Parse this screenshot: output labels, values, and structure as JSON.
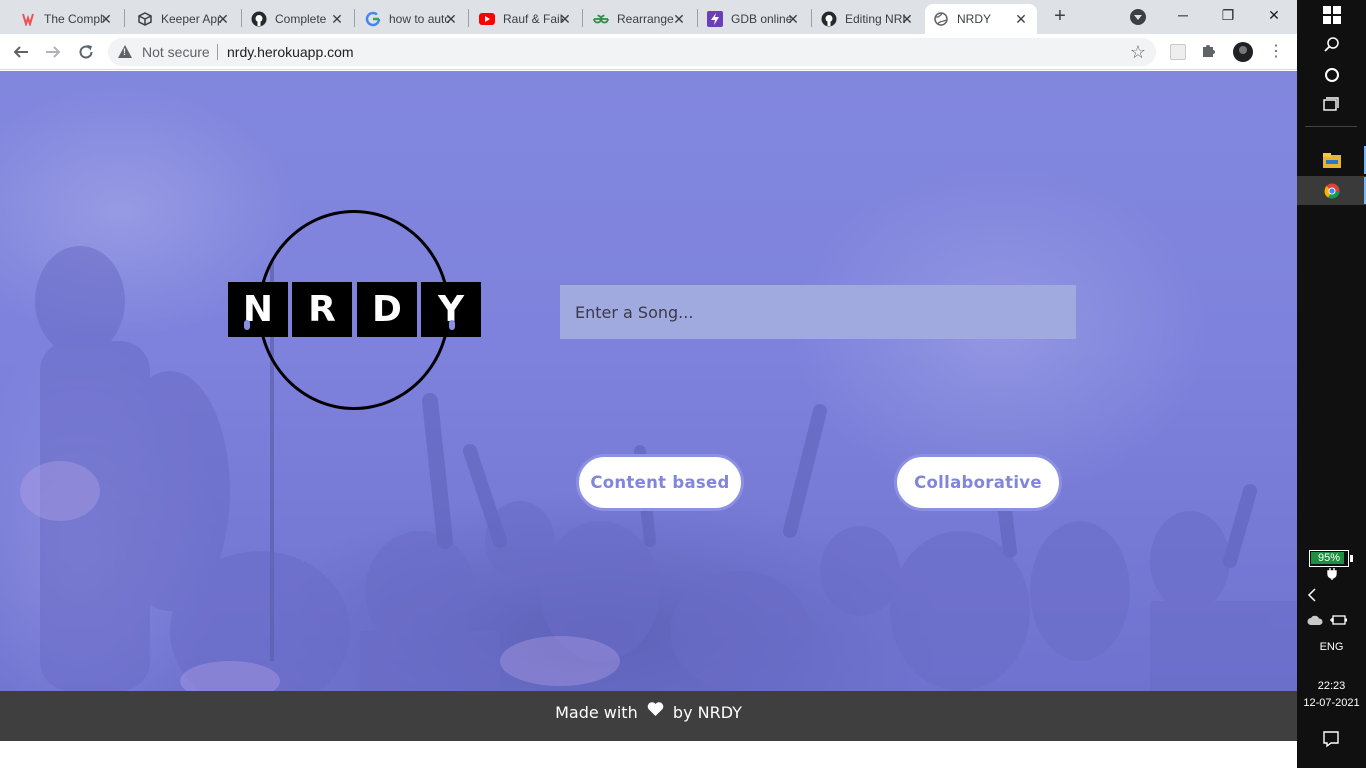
{
  "browser": {
    "tabs": [
      {
        "title": "The Complete",
        "icon": "udemy-icon",
        "color": "#ec5252"
      },
      {
        "title": "Keeper App",
        "icon": "cube-icon",
        "color": "#3c4043"
      },
      {
        "title": "Complete",
        "icon": "github-icon",
        "color": "#24292e"
      },
      {
        "title": "how to auto",
        "icon": "google-icon",
        "color": "#4285f4"
      },
      {
        "title": "Rauf & Faik",
        "icon": "youtube-icon",
        "color": "#ff0000"
      },
      {
        "title": "Rearrange",
        "icon": "geeksforgeeks-icon",
        "color": "#2f8d46"
      },
      {
        "title": "GDB online",
        "icon": "bolt-icon",
        "color": "#6c3fb5"
      },
      {
        "title": "Editing NRDY",
        "icon": "github-icon",
        "color": "#24292e"
      },
      {
        "title": "NRDY",
        "icon": "globe-icon",
        "color": "#5f6368",
        "active": true
      }
    ],
    "new_tab_symbol": "+",
    "window_controls": {
      "minimize": "─",
      "maximize": "❐",
      "close": "✕"
    },
    "security_label": "Not secure",
    "url": "nrdy.herokuapp.com"
  },
  "page": {
    "logo_letters": [
      "N",
      "R",
      "D",
      "Y"
    ],
    "search": {
      "placeholder": "Enter a Song...",
      "value": ""
    },
    "buttons": {
      "content_based": "Content based",
      "collaborative": "Collaborative"
    },
    "footer": {
      "prefix": "Made with",
      "suffix": "by NRDY"
    },
    "colors": {
      "hero": "#7e82dc",
      "accent": "#8185dc",
      "footer": "#3f3f3f",
      "search_bg": "#a0aade"
    }
  },
  "taskbar": {
    "battery": "95%",
    "battery_level": 0.95,
    "language": "ENG",
    "time": "22:23",
    "date": "12-07-2021"
  }
}
